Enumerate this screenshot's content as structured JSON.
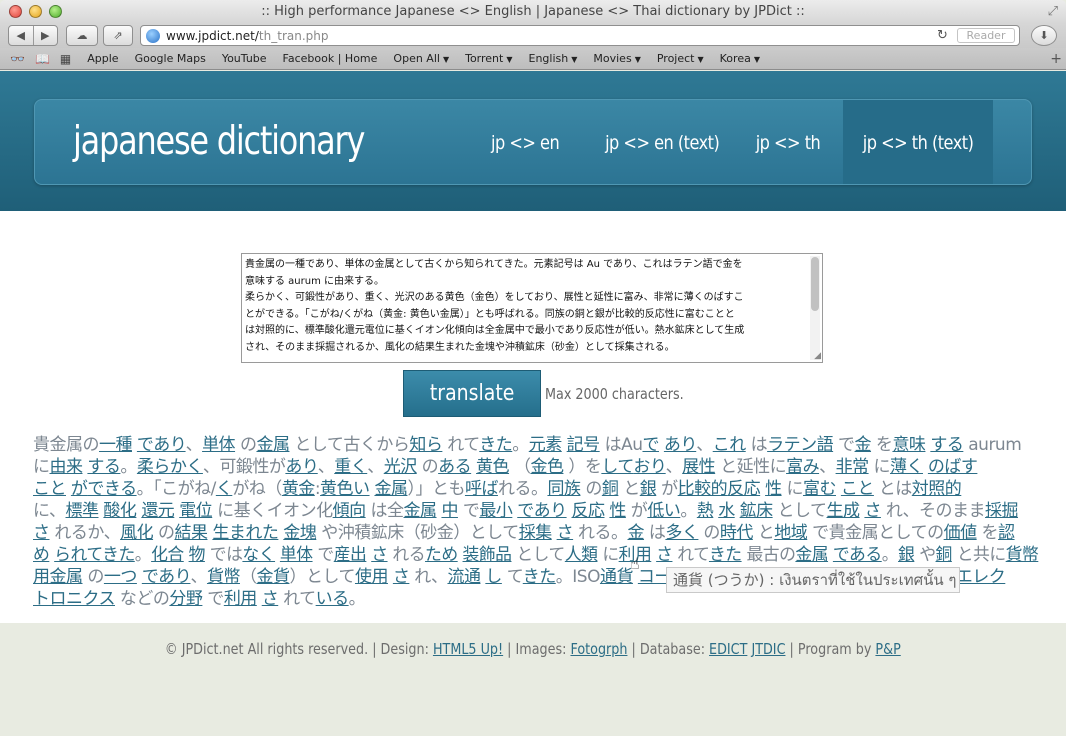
{
  "window": {
    "title": ":: High performance Japanese <> English | Japanese <> Thai dictionary by JPDict ::"
  },
  "toolbar": {
    "url_host": "www.jpdict.net/",
    "url_path": "th_tran.php",
    "reader_label": "Reader"
  },
  "bookmarks": [
    {
      "label": "Apple"
    },
    {
      "label": "Google Maps"
    },
    {
      "label": "YouTube"
    },
    {
      "label": "Facebook | Home"
    },
    {
      "label": "Open All",
      "menu": true
    },
    {
      "label": "Torrent",
      "menu": true
    },
    {
      "label": "English",
      "menu": true
    },
    {
      "label": "Movies",
      "menu": true
    },
    {
      "label": "Project",
      "menu": true
    },
    {
      "label": "Korea",
      "menu": true
    }
  ],
  "header": {
    "logo": "japanese dictionary",
    "nav": [
      "jp <> en",
      "jp <> en (text)",
      "jp <> th",
      "jp <> th (text)"
    ]
  },
  "input": {
    "lines": [
      "貴金属の一種であり、単体の金属として古くから知られてきた。元素記号は Au であり、これはラテン語で金を",
      "意味する aurum に由来する。",
      "柔らかく、可鍛性があり、重く、光沢のある黄色（金色）をしており、展性と延性に富み、非常に薄くのばすこ",
      "とができる。「こがね/くがね（黄金: 黄色い金属）」とも呼ばれる。同族の銅と銀が比較的反応性に富むことと",
      "は対照的に、標準酸化還元電位に基くイオン化傾向は全金属中で最小であり反応性が低い。熱水鉱床として生成",
      "され、そのまま採掘されるか、風化の結果生まれた金塊や沖積鉱床（砂金）として採集される。"
    ]
  },
  "translate": {
    "button_label": "translate",
    "max_note": "Max 2000 characters."
  },
  "result": {
    "lines": [
      [
        [
          "t",
          "貴金属の"
        ],
        [
          "w",
          "一種"
        ],
        [
          "t",
          " "
        ],
        [
          "w",
          "であり"
        ],
        [
          "t",
          "、"
        ],
        [
          "w",
          "単体"
        ],
        [
          "t",
          " の"
        ],
        [
          "w",
          "金属"
        ],
        [
          "t",
          " として古くから"
        ],
        [
          "w",
          "知ら"
        ],
        [
          "t",
          " れて"
        ],
        [
          "w",
          "きた"
        ],
        [
          "t",
          "。"
        ],
        [
          "w",
          "元素"
        ],
        [
          "t",
          " "
        ],
        [
          "w",
          "記号"
        ],
        [
          "t",
          " はAu"
        ],
        [
          "w",
          "で"
        ],
        [
          "t",
          " "
        ],
        [
          "w",
          "あり"
        ],
        [
          "t",
          "、"
        ],
        [
          "w",
          "これ"
        ],
        [
          "t",
          " は"
        ],
        [
          "w",
          "ラテン語"
        ],
        [
          "t",
          " で"
        ],
        [
          "w",
          "金"
        ],
        [
          "t",
          " を"
        ],
        [
          "w",
          "意味"
        ],
        [
          "t",
          " "
        ],
        [
          "w",
          "する"
        ],
        [
          "t",
          " aurum"
        ]
      ],
      [
        [
          "t",
          "に"
        ],
        [
          "w",
          "由来"
        ],
        [
          "t",
          " "
        ],
        [
          "w",
          "する"
        ],
        [
          "t",
          "。"
        ],
        [
          "w",
          "柔らかく"
        ],
        [
          "t",
          "、可鍛性が"
        ],
        [
          "w",
          "あり"
        ],
        [
          "t",
          "、"
        ],
        [
          "w",
          "重く"
        ],
        [
          "t",
          "、"
        ],
        [
          "w",
          "光沢"
        ],
        [
          "t",
          " の"
        ],
        [
          "w",
          "ある"
        ],
        [
          "t",
          " "
        ],
        [
          "w",
          "黄色"
        ],
        [
          "t",
          " （"
        ],
        [
          "w",
          "金色"
        ],
        [
          "t",
          " ）を"
        ],
        [
          "w",
          "して"
        ],
        [
          "w",
          "おり"
        ],
        [
          "t",
          "、"
        ],
        [
          "w",
          "展性"
        ],
        [
          "t",
          " と延性に"
        ],
        [
          "w",
          "富み"
        ],
        [
          "t",
          "、"
        ],
        [
          "w",
          "非常"
        ],
        [
          "t",
          " に"
        ],
        [
          "w",
          "薄く"
        ],
        [
          "t",
          " "
        ],
        [
          "w",
          "のばす"
        ]
      ],
      [
        [
          "w",
          "こと"
        ],
        [
          "t",
          " "
        ],
        [
          "w",
          "が"
        ],
        [
          "w",
          "できる"
        ],
        [
          "t",
          "。「こがね/"
        ],
        [
          "w",
          "く"
        ],
        [
          "t",
          "がね（"
        ],
        [
          "w",
          "黄金"
        ],
        [
          "t",
          ":"
        ],
        [
          "w",
          "黄色い"
        ],
        [
          "t",
          " "
        ],
        [
          "w",
          "金属"
        ],
        [
          "t",
          "）」とも"
        ],
        [
          "w",
          "呼ば"
        ],
        [
          "t",
          "れる。"
        ],
        [
          "w",
          "同族"
        ],
        [
          "t",
          " の"
        ],
        [
          "w",
          "銅"
        ],
        [
          "t",
          " と"
        ],
        [
          "w",
          "銀"
        ],
        [
          "t",
          " が"
        ],
        [
          "w",
          "比較的"
        ],
        [
          "w",
          "反応"
        ],
        [
          "t",
          " "
        ],
        [
          "w",
          "性"
        ],
        [
          "t",
          " に"
        ],
        [
          "w",
          "富む"
        ],
        [
          "t",
          " "
        ],
        [
          "w",
          "こと"
        ],
        [
          "t",
          " とは"
        ],
        [
          "w",
          "対照的"
        ]
      ],
      [
        [
          "t",
          "に、"
        ],
        [
          "w",
          "標準"
        ],
        [
          "t",
          " "
        ],
        [
          "w",
          "酸化"
        ],
        [
          "t",
          " "
        ],
        [
          "w",
          "還元"
        ],
        [
          "t",
          " "
        ],
        [
          "w",
          "電位"
        ],
        [
          "t",
          " に基くイオン化"
        ],
        [
          "w",
          "傾向"
        ],
        [
          "t",
          " は全"
        ],
        [
          "w",
          "金属"
        ],
        [
          "t",
          " "
        ],
        [
          "w",
          "中"
        ],
        [
          "t",
          " で"
        ],
        [
          "w",
          "最小"
        ],
        [
          "t",
          " "
        ],
        [
          "w",
          "であり"
        ],
        [
          "t",
          " "
        ],
        [
          "w",
          "反応"
        ],
        [
          "t",
          " "
        ],
        [
          "w",
          "性"
        ],
        [
          "t",
          " が"
        ],
        [
          "w",
          "低い"
        ],
        [
          "t",
          "。"
        ],
        [
          "w",
          "熱"
        ],
        [
          "t",
          " "
        ],
        [
          "w",
          "水"
        ],
        [
          "t",
          " "
        ],
        [
          "w",
          "鉱床"
        ],
        [
          "t",
          " として"
        ],
        [
          "w",
          "生成"
        ],
        [
          "t",
          " "
        ],
        [
          "w",
          "さ"
        ],
        [
          "t",
          " れ、そのまま"
        ],
        [
          "w",
          "採掘"
        ]
      ],
      [
        [
          "w",
          "さ"
        ],
        [
          "t",
          " れるか、"
        ],
        [
          "w",
          "風化"
        ],
        [
          "t",
          " の"
        ],
        [
          "w",
          "結果"
        ],
        [
          "t",
          " "
        ],
        [
          "w",
          "生まれた"
        ],
        [
          "t",
          " "
        ],
        [
          "w",
          "金塊"
        ],
        [
          "t",
          " や沖積鉱床（砂金）として"
        ],
        [
          "w",
          "採集"
        ],
        [
          "t",
          " "
        ],
        [
          "w",
          "さ"
        ],
        [
          "t",
          " れる。"
        ],
        [
          "w",
          "金"
        ],
        [
          "t",
          " は"
        ],
        [
          "w",
          "多く"
        ],
        [
          "t",
          " の"
        ],
        [
          "w",
          "時代"
        ],
        [
          "t",
          " と"
        ],
        [
          "w",
          "地域"
        ],
        [
          "t",
          " で貴金属としての"
        ],
        [
          "w",
          "価値"
        ],
        [
          "t",
          " を"
        ],
        [
          "w",
          "認"
        ]
      ],
      [
        [
          "w",
          "め"
        ],
        [
          "t",
          " "
        ],
        [
          "w",
          "られて"
        ],
        [
          "w",
          "きた"
        ],
        [
          "t",
          "。"
        ],
        [
          "w",
          "化合"
        ],
        [
          "t",
          " "
        ],
        [
          "w",
          "物"
        ],
        [
          "t",
          " では"
        ],
        [
          "w",
          "なく"
        ],
        [
          "t",
          " "
        ],
        [
          "w",
          "単体"
        ],
        [
          "t",
          " で"
        ],
        [
          "w",
          "産出"
        ],
        [
          "t",
          " "
        ],
        [
          "w",
          "さ"
        ],
        [
          "t",
          " れる"
        ],
        [
          "w",
          "ため"
        ],
        [
          "t",
          " "
        ],
        [
          "w",
          "装飾品"
        ],
        [
          "t",
          " として"
        ],
        [
          "w",
          "人類"
        ],
        [
          "t",
          " に"
        ],
        [
          "w",
          "利用"
        ],
        [
          "t",
          " "
        ],
        [
          "w",
          "さ"
        ],
        [
          "t",
          " れて"
        ],
        [
          "w",
          "きた"
        ],
        [
          "t",
          " 最古の"
        ],
        [
          "w",
          "金属"
        ],
        [
          "t",
          " "
        ],
        [
          "w",
          "である"
        ],
        [
          "t",
          "。"
        ],
        [
          "w",
          "銀"
        ],
        [
          "t",
          " や"
        ],
        [
          "w",
          "銅"
        ],
        [
          "t",
          " と共に"
        ],
        [
          "w",
          "貨幣"
        ]
      ],
      [
        [
          "w",
          "用"
        ],
        [
          "w",
          "金属"
        ],
        [
          "t",
          " の"
        ],
        [
          "w",
          "一つ"
        ],
        [
          "t",
          " "
        ],
        [
          "w",
          "であり"
        ],
        [
          "t",
          "、"
        ],
        [
          "w",
          "貨幣"
        ],
        [
          "t",
          "（"
        ],
        [
          "w",
          "金貨"
        ],
        [
          "t",
          "）として"
        ],
        [
          "w",
          "使用"
        ],
        [
          "t",
          " "
        ],
        [
          "w",
          "さ"
        ],
        [
          "t",
          " れ、"
        ],
        [
          "w",
          "流通"
        ],
        [
          "t",
          " "
        ],
        [
          "w",
          "し"
        ],
        [
          "t",
          " て"
        ],
        [
          "w",
          "きた"
        ],
        [
          "t",
          "。ISO"
        ],
        [
          "w",
          "通貨"
        ],
        [
          "t",
          " "
        ],
        [
          "w",
          "コード"
        ],
        [
          "t",
          " ではXAUと"
        ],
        [
          "w",
          "あらわす"
        ],
        [
          "t",
          "。また、"
        ],
        [
          "w",
          "医術"
        ],
        [
          "t",
          "、"
        ],
        [
          "w",
          "エレク"
        ]
      ],
      [
        [
          "w",
          "トロニクス"
        ],
        [
          "t",
          " などの"
        ],
        [
          "w",
          "分野"
        ],
        [
          "t",
          " で"
        ],
        [
          "w",
          "利用"
        ],
        [
          "t",
          " "
        ],
        [
          "w",
          "さ"
        ],
        [
          "t",
          " れて"
        ],
        [
          "w",
          "いる"
        ],
        [
          "t",
          "。"
        ]
      ]
    ],
    "tooltip": "通貨 (つうか) : เงินตราที่ใช้ในประเทศนั้น ๆ"
  },
  "footer": {
    "text_1": "© JPDict.net All rights reserved. | Design: ",
    "link_design": "HTML5 Up!",
    "text_2": " | Images: ",
    "link_images": "Fotogrph",
    "text_3": " | Database: ",
    "link_edict": "EDICT",
    "link_jtdic": "JTDIC",
    "text_4": " | Program by ",
    "link_program": "P&P"
  },
  "colors": {
    "header_bg": "#2a7090",
    "accent": "#2c6d86",
    "footer_bg": "#e8ebe1"
  }
}
